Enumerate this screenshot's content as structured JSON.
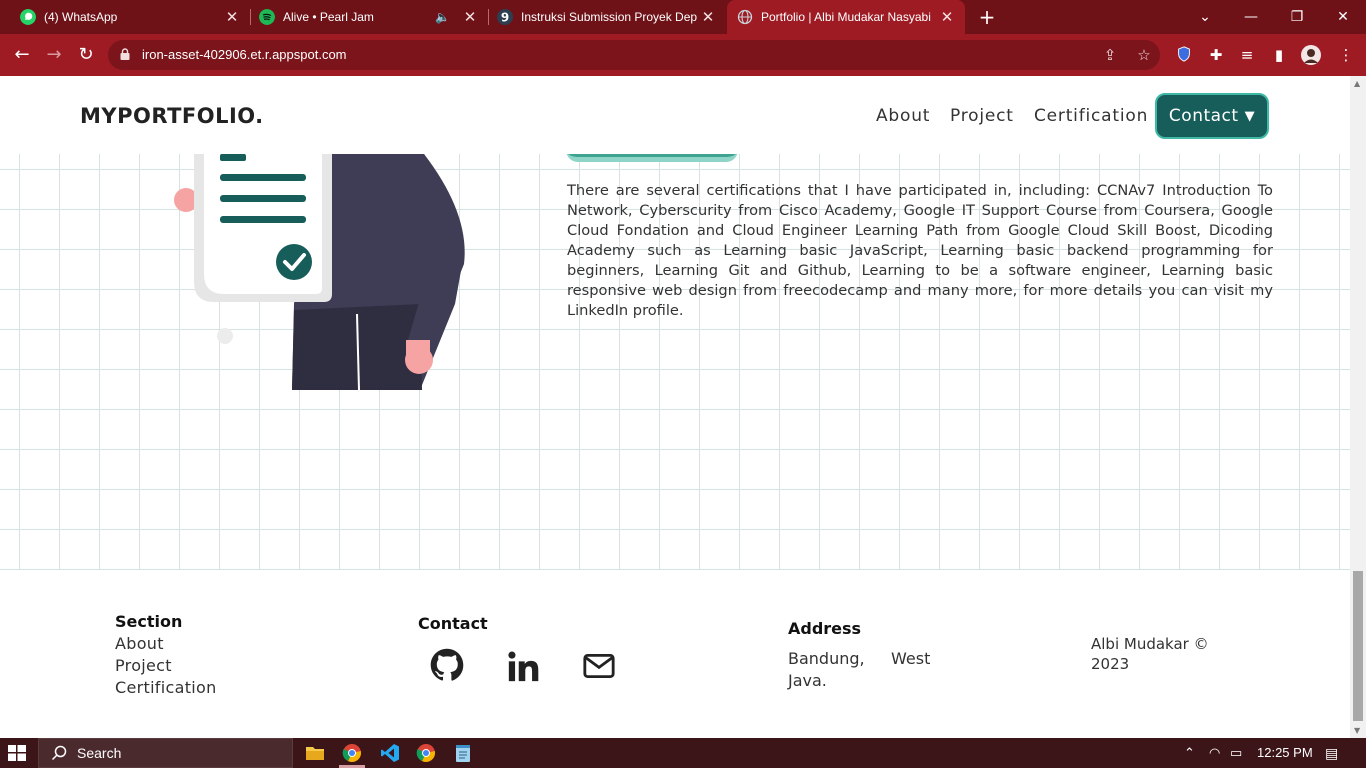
{
  "browser": {
    "tabs": [
      {
        "label": "(4) WhatsApp",
        "favicon": "whatsapp-icon",
        "color": "#25d366"
      },
      {
        "label": "Alive • Pearl Jam",
        "favicon": "spotify-icon",
        "color": "#1db954"
      },
      {
        "label": "Instruksi Submission Proyek Dep",
        "favicon": "dicoding-icon",
        "color": "#2d3e50"
      },
      {
        "label": "Portfolio | Albi Mudakar Nasyabi",
        "favicon": "globe-icon",
        "color": "#9aa0a6"
      }
    ],
    "new_tab": "+",
    "url": "iron-asset-402906.et.r.appspot.com"
  },
  "page": {
    "logo": "MYPORTFOLIO.",
    "nav": {
      "about": "About",
      "project": "Project",
      "certification": "Certification",
      "contact": "Contact"
    },
    "certification_text": "There are several certifications that I have participated in, including: CCNAv7 Introduction To Network, Cyberscurity from Cisco Academy, Google IT Support Course from Coursera, Google Cloud Fondation and Cloud Engineer Learning Path from Google Cloud Skill Boost, Dicoding Academy such as Learning basic JavaScript, Learning basic backend programming for beginners, Learning Git and Github, Learning to be a software engineer, Learning basic responsive web design from freecodecamp and many more, for more details you can visit my LinkedIn profile.",
    "footer": {
      "section_heading": "Section",
      "section_links": [
        "About",
        "Project",
        "Certification"
      ],
      "contact_heading": "Contact",
      "social_icons": [
        "github-icon",
        "linkedin-icon",
        "mail-icon"
      ],
      "address_heading": "Address",
      "address_line1_a": "Bandung,",
      "address_line1_b": "West",
      "address_line2": "Java.",
      "copyright_line1": "Albi Mudakar ©",
      "copyright_line2": "2023"
    },
    "colors": {
      "accent": "#175d5a",
      "accent_border": "#3fb9a5",
      "browser_frame": "#9e1b24"
    }
  },
  "taskbar": {
    "search_label": "Search",
    "time": "12:25 PM"
  }
}
